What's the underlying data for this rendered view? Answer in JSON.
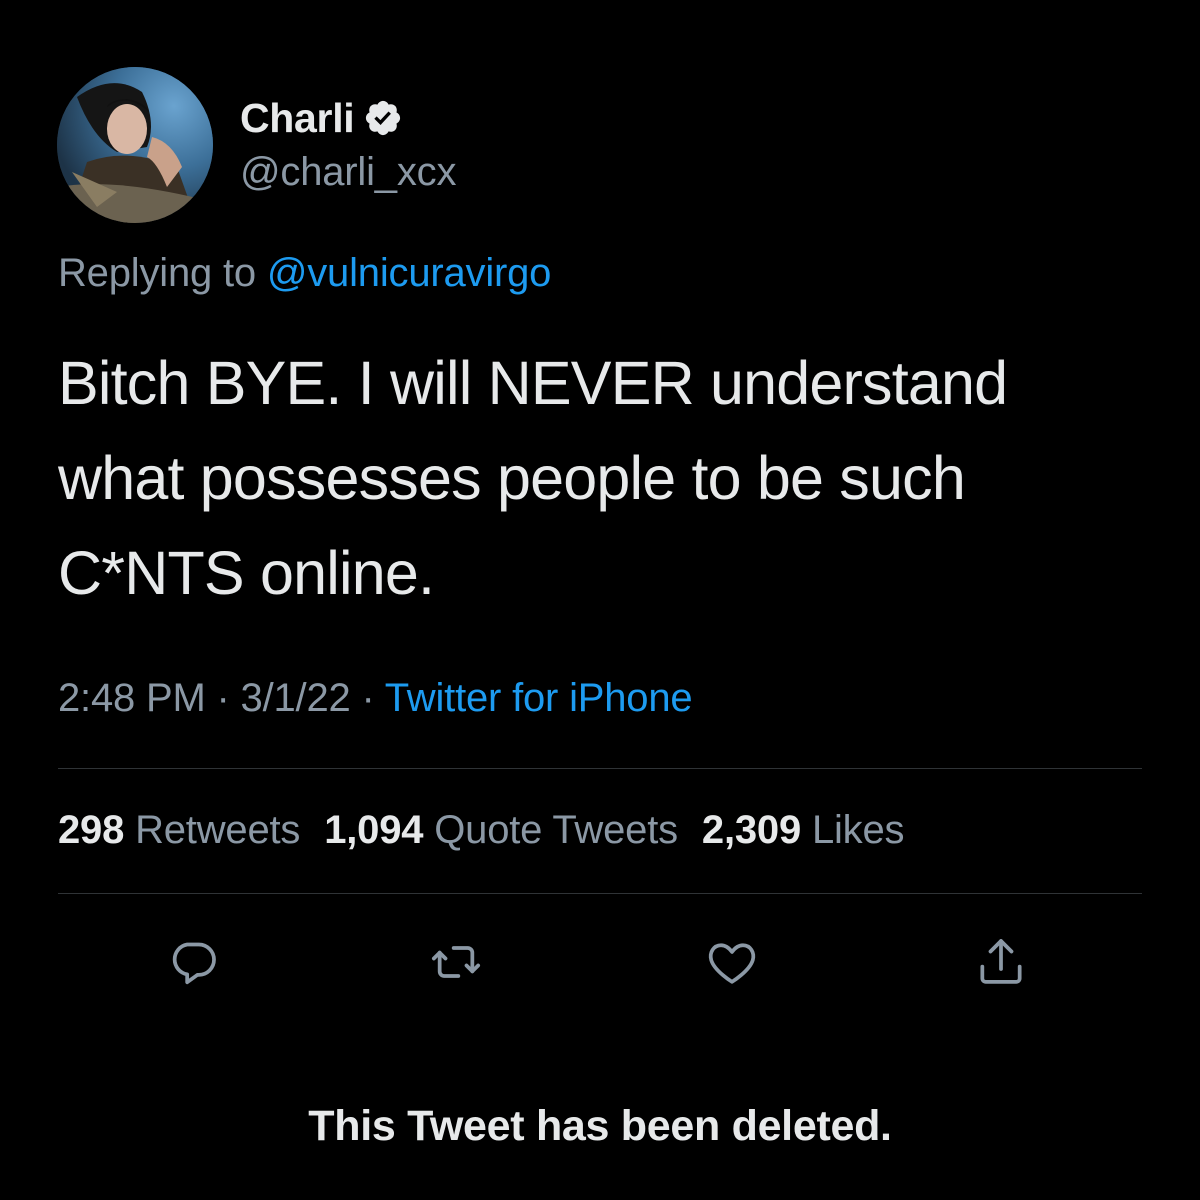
{
  "author": {
    "display_name": "Charli",
    "handle": "@charli_xcx",
    "verified": true,
    "avatar_icon": "profile-photo"
  },
  "reply": {
    "prefix": "Replying to ",
    "mention": "@vulnicuravirgo"
  },
  "tweet": {
    "text_line1": "Bitch BYE. I will NEVER understand",
    "text_line2": "what possesses people to be such",
    "text_line3": "C*NTS online."
  },
  "meta": {
    "time": "2:48 PM",
    "separator": " · ",
    "date": "3/1/22",
    "source": "Twitter for iPhone"
  },
  "stats": {
    "retweets_count": "298",
    "retweets_label": "Retweets",
    "quotes_count": "1,094",
    "quotes_label": "Quote Tweets",
    "likes_count": "2,309",
    "likes_label": "Likes"
  },
  "actions": {
    "reply_icon": "reply-icon",
    "retweet_icon": "retweet-icon",
    "like_icon": "heart-icon",
    "share_icon": "share-icon"
  },
  "status": {
    "deleted_message": "This Tweet has been deleted."
  },
  "colors": {
    "background": "#000000",
    "text": "#e7e9ea",
    "secondary": "#8b98a5",
    "link": "#1d9bf0",
    "divider": "#2f3336"
  }
}
